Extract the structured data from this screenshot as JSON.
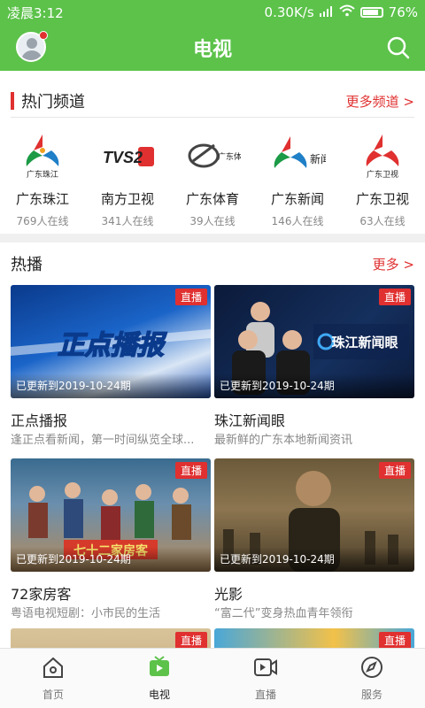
{
  "status_bar": {
    "time": "凌晨3:12",
    "speed": "0.30K/s",
    "battery": "76%"
  },
  "app_bar": {
    "title": "电视"
  },
  "hot_channels": {
    "title": "热门频道",
    "more": "更多频道 >",
    "items": [
      {
        "name": "广东珠江",
        "online": "769人在线",
        "logo_text": "广东珠江"
      },
      {
        "name": "南方卫视",
        "online": "341人在线",
        "logo_text": "TVS2"
      },
      {
        "name": "广东体育",
        "online": "39人在线",
        "logo_text": "广东体育"
      },
      {
        "name": "广东新闻",
        "online": "146人在线",
        "logo_text": "新闻"
      },
      {
        "name": "广东卫视",
        "online": "63人在线",
        "logo_text": "广东卫视"
      }
    ]
  },
  "hot_play": {
    "title": "热播",
    "more": "更多 >",
    "items": [
      {
        "title": "正点播报",
        "desc": "逢正点看新闻，第一时间纵览全球...",
        "updated": "已更新到2019-10-24期",
        "badge": "直播",
        "thumb_text": "正点播报"
      },
      {
        "title": "珠江新闻眼",
        "desc": "最新鲜的广东本地新闻资讯",
        "updated": "已更新到2019-10-24期",
        "badge": "直播",
        "thumb_text": "珠江新闻眼"
      },
      {
        "title": "72家房客",
        "desc": "粤语电视短剧：小市民的生活",
        "updated": "已更新到2019-10-24期",
        "badge": "直播",
        "thumb_text": "七十二家房客"
      },
      {
        "title": "光影",
        "desc": "“富二代”变身热血青年领衔",
        "updated": "已更新到2019-10-24期",
        "badge": "直播",
        "thumb_text": ""
      },
      {
        "badge": "直播"
      },
      {
        "badge": "直播"
      }
    ]
  },
  "tabs": [
    {
      "label": "首页"
    },
    {
      "label": "电视"
    },
    {
      "label": "直播"
    },
    {
      "label": "服务"
    }
  ],
  "colors": {
    "brand_green": "#5cc24a",
    "accent_red": "#e03030"
  }
}
